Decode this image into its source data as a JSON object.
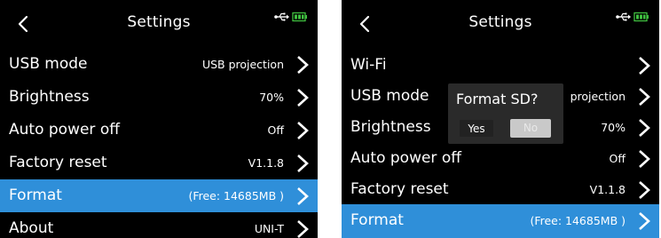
{
  "colors": {
    "background": "#000000",
    "selected_row": "#2f8fd9",
    "text": "#ffffff",
    "dialog_bg": "#2a2a2a",
    "no_button_bg": "#c9c9c9"
  },
  "left_screen": {
    "title": "Settings",
    "back_icon": "chevron-left",
    "status_icons": [
      "usb-icon",
      "battery-icon"
    ],
    "rows": [
      {
        "label": "USB mode",
        "value": "USB projection",
        "selected": false
      },
      {
        "label": "Brightness",
        "value": "70%",
        "selected": false
      },
      {
        "label": "Auto power off",
        "value": "Off",
        "selected": false
      },
      {
        "label": "Factory reset",
        "value": "V1.1.8",
        "selected": false
      },
      {
        "label": "Format",
        "value": "(Free: 14685MB )",
        "selected": true
      },
      {
        "label": "About",
        "value": "UNI-T",
        "selected": false
      }
    ]
  },
  "right_screen": {
    "title": "Settings",
    "back_icon": "chevron-left",
    "status_icons": [
      "usb-icon",
      "battery-icon"
    ],
    "rows": [
      {
        "label": "Wi-Fi",
        "value": "",
        "selected": false
      },
      {
        "label": "USB mode",
        "value": "projection",
        "selected": false
      },
      {
        "label": "Brightness",
        "value": "70%",
        "selected": false
      },
      {
        "label": "Auto power off",
        "value": "Off",
        "selected": false
      },
      {
        "label": "Factory reset",
        "value": "V1.1.8",
        "selected": false
      },
      {
        "label": "Format",
        "value": "(Free: 14685MB )",
        "selected": true
      }
    ],
    "dialog": {
      "title": "Format SD?",
      "yes_label": "Yes",
      "no_label": "No"
    }
  }
}
